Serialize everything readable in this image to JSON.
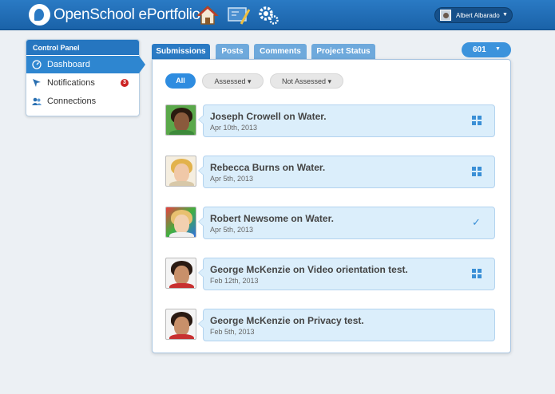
{
  "header": {
    "brand": "OpenSchool ePortfolio",
    "icons": [
      "logo-icon",
      "home-icon",
      "blackboard-icon",
      "gears-icon"
    ],
    "user_name": "Albert Albarado",
    "bg_color": "#1d6bb5"
  },
  "sidebar": {
    "title": "Control Panel",
    "items": [
      {
        "label": "Dashboard",
        "icon": "dashboard-icon",
        "active": true
      },
      {
        "label": "Notifications",
        "icon": "cursor-icon",
        "badge": "3"
      },
      {
        "label": "Connections",
        "icon": "users-icon"
      }
    ]
  },
  "tabs": [
    {
      "label": "Submissions",
      "active": true
    },
    {
      "label": "Posts"
    },
    {
      "label": "Comments"
    },
    {
      "label": "Project Status"
    }
  ],
  "count_dropdown": "601",
  "filters": [
    {
      "label": "All",
      "selected": true
    },
    {
      "label": "Assessed ▾"
    },
    {
      "label": "Not Assessed ▾"
    }
  ],
  "submissions": [
    {
      "title": "Joseph Crowell on Water.",
      "date": "Apr 10th, 2013",
      "status_icon": "grid-icon"
    },
    {
      "title": "Rebecca Burns on Water.",
      "date": "Apr 5th, 2013",
      "status_icon": "grid-icon"
    },
    {
      "title": "Robert Newsome on Water.",
      "date": "Apr 5th, 2013",
      "status_icon": "check-icon"
    },
    {
      "title": "George McKenzie on Video orientation test.",
      "date": "Feb 12th, 2013",
      "status_icon": "grid-icon"
    },
    {
      "title": "George McKenzie on Privacy test.",
      "date": "Feb 5th, 2013",
      "status_icon": "none"
    }
  ],
  "colors": {
    "accent": "#2a7ac4",
    "badge": "#cc2222",
    "card": "#dbeefb"
  }
}
